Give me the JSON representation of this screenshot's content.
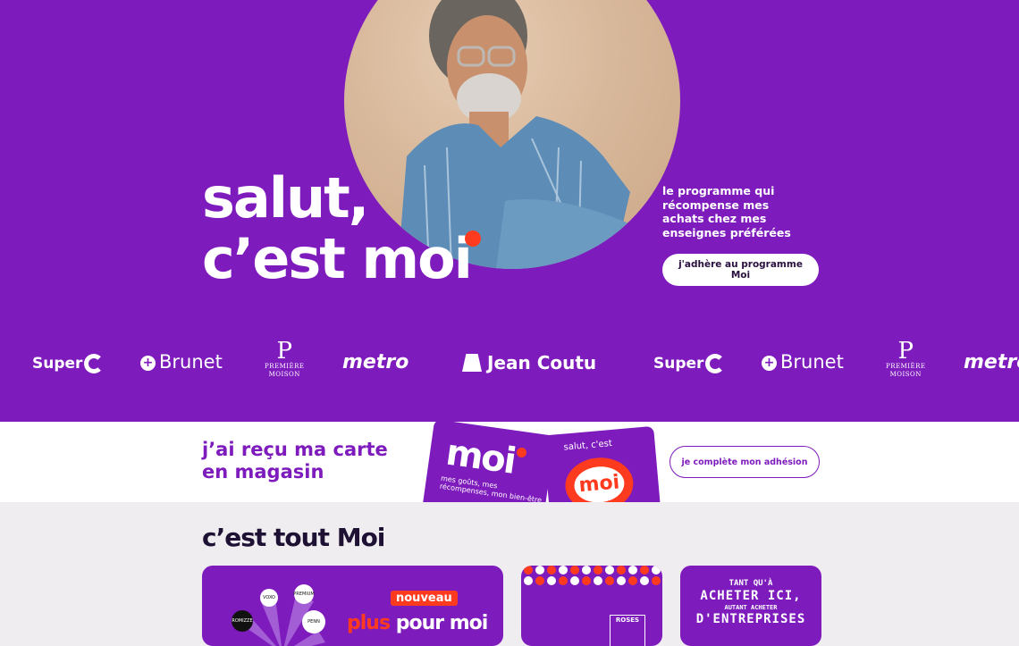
{
  "hero": {
    "headline_line1": "salut,",
    "headline_line2_a": "c’est ",
    "headline_line2_b": "moi",
    "tagline": "le programme qui récompense mes achats chez mes enseignes préférées",
    "cta_join": "j'adhère au programme Moi"
  },
  "logos": {
    "superc": "Super",
    "brunet": "Brunet",
    "premiere_p": "P",
    "premiere_text1": "PREMIÈRE",
    "premiere_text2": "MOISON",
    "metro": "metro",
    "jeancoutu": "Jean Coutu"
  },
  "card_band": {
    "title": "j’ai reçu ma carte en magasin",
    "card1_word": "moi",
    "card1_sub": "mes goûts, mes récompenses, mon bien-être",
    "card2_top": "salut, c'est",
    "card2_word": "moi",
    "cta_complete": "je complète mon adhésion"
  },
  "section": {
    "title": "c’est tout Moi",
    "tile1_badge": "nouveau",
    "tile1_text_a": "plus",
    "tile1_text_b": " pour moi",
    "tile1_brands": [
      "VOXO",
      "PENN",
      "ROMIZZE",
      "PREMIUM"
    ],
    "tile2_label": "ROSES",
    "tile3_line1": "TANT QU'À",
    "tile3_line2": "ACHETER ICI,",
    "tile3_line3": "AUTANT ACHETER",
    "tile3_line4": "D'ENTREPRISES"
  },
  "colors": {
    "brand_purple": "#7e1bbd",
    "accent_red": "#ff3b1f",
    "white": "#ffffff"
  }
}
